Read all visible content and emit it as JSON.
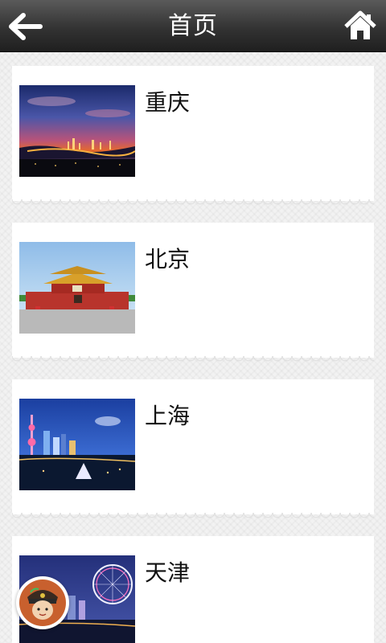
{
  "header": {
    "title": "首页",
    "back_icon": "back-arrow-icon",
    "home_icon": "home-icon"
  },
  "cities": [
    {
      "name": "重庆",
      "image": "chongqing-night-skyline-photo"
    },
    {
      "name": "北京",
      "image": "tiananmen-gate-photo"
    },
    {
      "name": "上海",
      "image": "shanghai-night-skyline-photo"
    },
    {
      "name": "天津",
      "image": "tianjin-eye-ferris-wheel-photo"
    }
  ],
  "floating_button": {
    "icon": "police-mascot-avatar-icon"
  },
  "colors": {
    "header_top": "#5a5a5a",
    "header_bottom": "#1f1f1f",
    "card": "#ffffff",
    "background": "#f2f2f2"
  }
}
